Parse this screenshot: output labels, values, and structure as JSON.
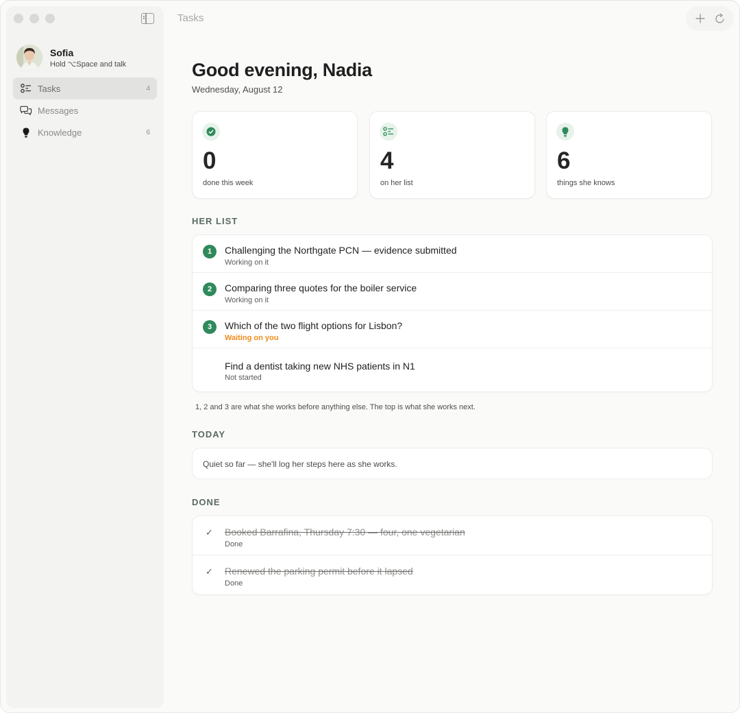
{
  "window": {
    "title": "Tasks"
  },
  "sidebar": {
    "profile": {
      "name": "Sofia",
      "hint": "Hold ⌥Space and talk"
    },
    "items": [
      {
        "label": "Tasks",
        "count": "4",
        "icon": "list-icon",
        "active": true
      },
      {
        "label": "Messages",
        "count": "",
        "icon": "chat-bubbles-icon",
        "active": false
      },
      {
        "label": "Knowledge",
        "count": "6",
        "icon": "lightbulb-icon",
        "active": false
      }
    ]
  },
  "main": {
    "greeting": "Good evening, Nadia",
    "date": "Wednesday, August 12",
    "stats": [
      {
        "value": "0",
        "caption": "done this week",
        "icon": "check-circle-icon"
      },
      {
        "value": "4",
        "caption": "on her list",
        "icon": "list-icon"
      },
      {
        "value": "6",
        "caption": "things she knows",
        "icon": "lightbulb-icon"
      }
    ],
    "her_list": {
      "label": "HER LIST",
      "items": [
        {
          "rank": "1",
          "title": "Challenging the Northgate PCN — evidence submitted",
          "status": "Working on it"
        },
        {
          "rank": "2",
          "title": "Comparing three quotes for the boiler service",
          "status": "Working on it"
        },
        {
          "rank": "3",
          "title": "Which of the two flight options for Lisbon?",
          "status": "Waiting on you"
        },
        {
          "rank": "",
          "title": "Find a dentist taking new NHS patients in N1",
          "status": "Not started"
        }
      ],
      "hint": "1, 2 and 3 are what she works before anything else. The top is what she works next."
    },
    "today": {
      "label": "TODAY",
      "empty_text": "Quiet so far — she'll log her steps here as she works."
    },
    "done": {
      "label": "DONE",
      "items": [
        {
          "title": "Booked Barrafina, Thursday 7:30 — four, one vegetarian",
          "status": "Done"
        },
        {
          "title": "Renewed the parking permit before it lapsed",
          "status": "Done"
        }
      ]
    }
  },
  "colors": {
    "accent": "#2f8a5b",
    "waiting": "#f08c1a",
    "badge_bg": "#e6f2ea"
  }
}
